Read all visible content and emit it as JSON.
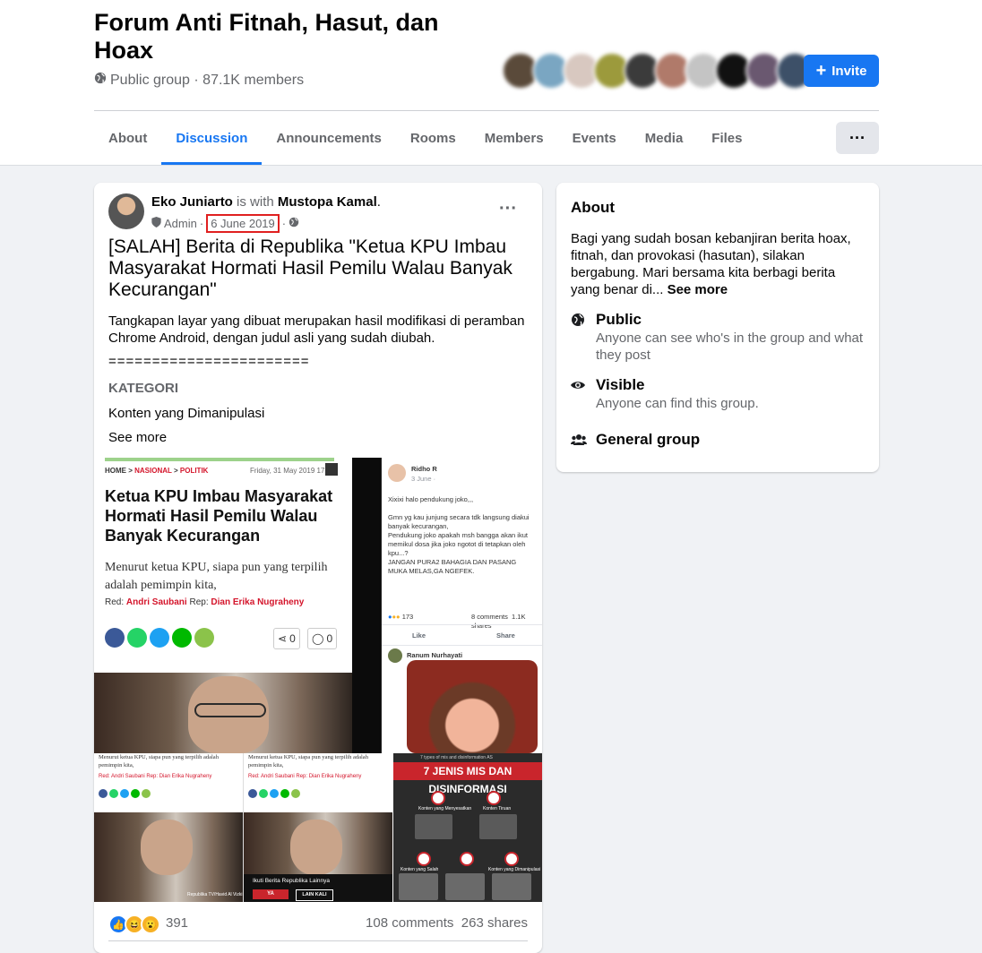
{
  "group": {
    "title": "Forum Anti Fitnah, Hasut, dan Hoax",
    "subtitle": "Public group · 87.1K members",
    "invite_label": "Invite"
  },
  "tabs": [
    {
      "label": "About",
      "active": false
    },
    {
      "label": "Discussion",
      "active": true
    },
    {
      "label": "Announcements",
      "active": false
    },
    {
      "label": "Rooms",
      "active": false
    },
    {
      "label": "Members",
      "active": false
    },
    {
      "label": "Events",
      "active": false
    },
    {
      "label": "Media",
      "active": false
    },
    {
      "label": "Files",
      "active": false
    }
  ],
  "more_label": "···",
  "post": {
    "author": "Eko Juniarto",
    "with_text": "is with",
    "with_name": "Mustopa Kamal",
    "role": "Admin",
    "date": "6 June 2019",
    "title": "[SALAH] Berita di Republika \"Ketua KPU Imbau Masyarakat Hormati Hasil Pemilu Walau Banyak Kecurangan\"",
    "body": "Tangkapan layar yang dibuat merupakan hasil modifikasi di peramban Chrome Android, dengan judul asli yang sudah diubah.",
    "separator": "=======================",
    "category_label": "KATEGORI",
    "category_value": "Konten yang Dimanipulasi",
    "see_more": "See more",
    "reaction_count": "391",
    "comments": "108 comments",
    "shares": "263 shares"
  },
  "image1": {
    "crumb_home": "HOME",
    "crumb_nasional": "NASIONAL",
    "crumb_politik": "POLITIK",
    "date": "Friday, 31 May 2019 17:2",
    "headline": "Ketua KPU Imbau Masyarakat Hormati Hasil Pemilu Walau Banyak Kecurangan",
    "lede": "Menurut ketua KPU, siapa pun yang terpilih adalah pemimpin kita,",
    "red_label": "Red:",
    "red_name": "Andri Saubani",
    "rep_label": "Rep:",
    "rep_name": "Dian Erika Nugraheny",
    "share_count": "0",
    "comment_count": "0"
  },
  "image2": {
    "name": "Ridho R",
    "date": "3 June ·",
    "line1": "Xixixi halo pendukung joko,,,",
    "line2": "Gmn yg kau junjung secara tdk langsung diakui banyak kecurangan,",
    "line3": "Pendukung joko apakah msh bangga akan ikut memikul dosa jika joko ngotot di tetapkan oleh kpu...?",
    "line4": "JANGAN PURA2 BAHAGIA DAN PASANG MUKA MELAS,GA NGEFEK.",
    "react_count": "173",
    "comments": "8 comments",
    "shares": "1.1K shares",
    "like": "Like",
    "share": "Share",
    "commenter": "Ranum Nurhayati"
  },
  "thumbs": {
    "t1_lede": "Menurut ketua KPU, siapa pun yang terpilih adalah pemimpin kita,",
    "t1_byline": "Red: Andri Saubani Rep: Dian Erika Nugraheny",
    "t1_credit": "Republika TV/Havid Al Vizki",
    "t2_lede": "Menurut ketua KPU, siapa pun yang terpilih adalah pemimpin kita,",
    "t2_byline": "Red: Andri Saubani Rep: Dian Erika Nugraheny",
    "t2_prompt": "Ikuti Berita Republika Lainnya",
    "t2_yes": "YA",
    "t2_later": "LAIN KALI",
    "t3_small": "7 types of mis and disinformation AS",
    "t3_head": "7 JENIS MIS DAN DISINFORMASI",
    "t3_box1": "Konten yang Menyesatkan",
    "t3_box2": "Konten Tiruan",
    "t3_box3": "Konten yang Salah",
    "t3_box4": "Konten yang Dimanipulasi"
  },
  "about": {
    "heading": "About",
    "description": "Bagi yang sudah bosan kebanjiran berita hoax, fitnah, dan provokasi (hasutan), silakan bergabung. Mari bersama kita berbagi berita yang benar di...",
    "see_more": "See more",
    "public_title": "Public",
    "public_desc": "Anyone can see who's in the group and what they post",
    "visible_title": "Visible",
    "visible_desc": "Anyone can find this group.",
    "general_title": "General group"
  },
  "colors": {
    "accent": "#1877f2",
    "highlight": "#e02020",
    "background": "#f0f2f5"
  }
}
